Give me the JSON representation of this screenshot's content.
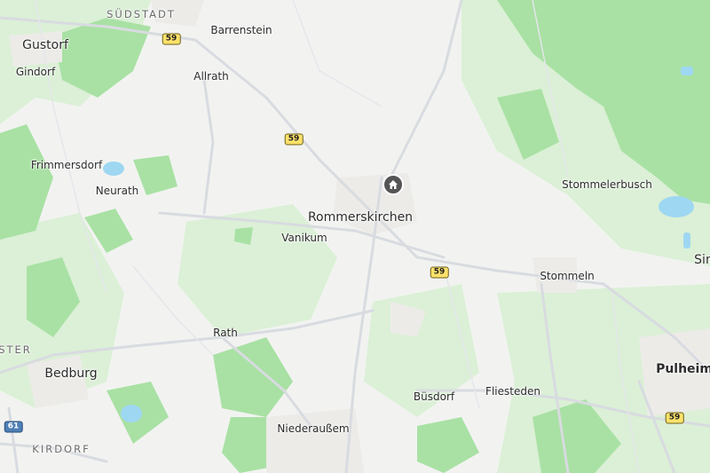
{
  "map": {
    "places": {
      "suedstadt": "SÜDSTADT",
      "gustorf": "Gustorf",
      "barrenstein": "Barrenstein",
      "gindorf": "Gindorf",
      "allrath": "Allrath",
      "frimmersdorf": "Frimmersdorf",
      "neurath": "Neurath",
      "stommelerbusch": "Stommelerbusch",
      "rommerskirchen": "Rommerskirchen",
      "vanikum": "Vanikum",
      "stommeln": "Stommeln",
      "sin_partial": "Sin",
      "rath": "Rath",
      "ster_partial": "STER",
      "bedburg": "Bedburg",
      "pulheim": "Pulheim",
      "buesdorf": "Büsdorf",
      "fliesteden": "Fliesteden",
      "niederaussem": "Niederaußem",
      "kirdorf": "KIRDORF"
    },
    "road_shields": {
      "b59_a": "59",
      "b59_b": "59",
      "b59_c": "59",
      "b59_d": "59",
      "a61": "61"
    },
    "poi": {
      "icon": "home-icon",
      "color": "#555555"
    },
    "colors": {
      "background": "#f2f3f1",
      "forest": "#a9e1a4",
      "light_green": "#d6efcf",
      "water": "#9ed7f2",
      "road": "#d9dce1",
      "road_shield": "#fde26a"
    }
  }
}
